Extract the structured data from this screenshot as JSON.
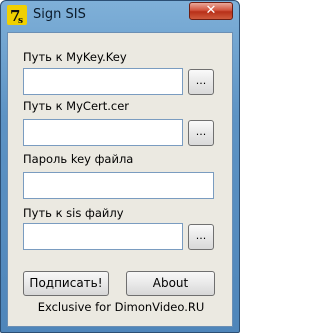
{
  "window": {
    "title": "Sign SIS",
    "close_glyph": "✕",
    "icon": "app-logo-icon"
  },
  "fields": [
    {
      "label": "Путь к MyKey.Key",
      "value": "",
      "browse_label": "..."
    },
    {
      "label": "Путь к MyCert.cer",
      "value": "",
      "browse_label": "..."
    },
    {
      "label": "Пароль key файла",
      "value": ""
    },
    {
      "label": "Путь к sis файлу",
      "value": "",
      "browse_label": "..."
    }
  ],
  "buttons": {
    "sign_label": "Подписать!",
    "about_label": "About"
  },
  "footer": "Exclusive for DimonVideo.RU",
  "colors": {
    "titlebar": "#5d93c4",
    "close": "#c2422a",
    "client_bg": "#ebe9e1"
  }
}
